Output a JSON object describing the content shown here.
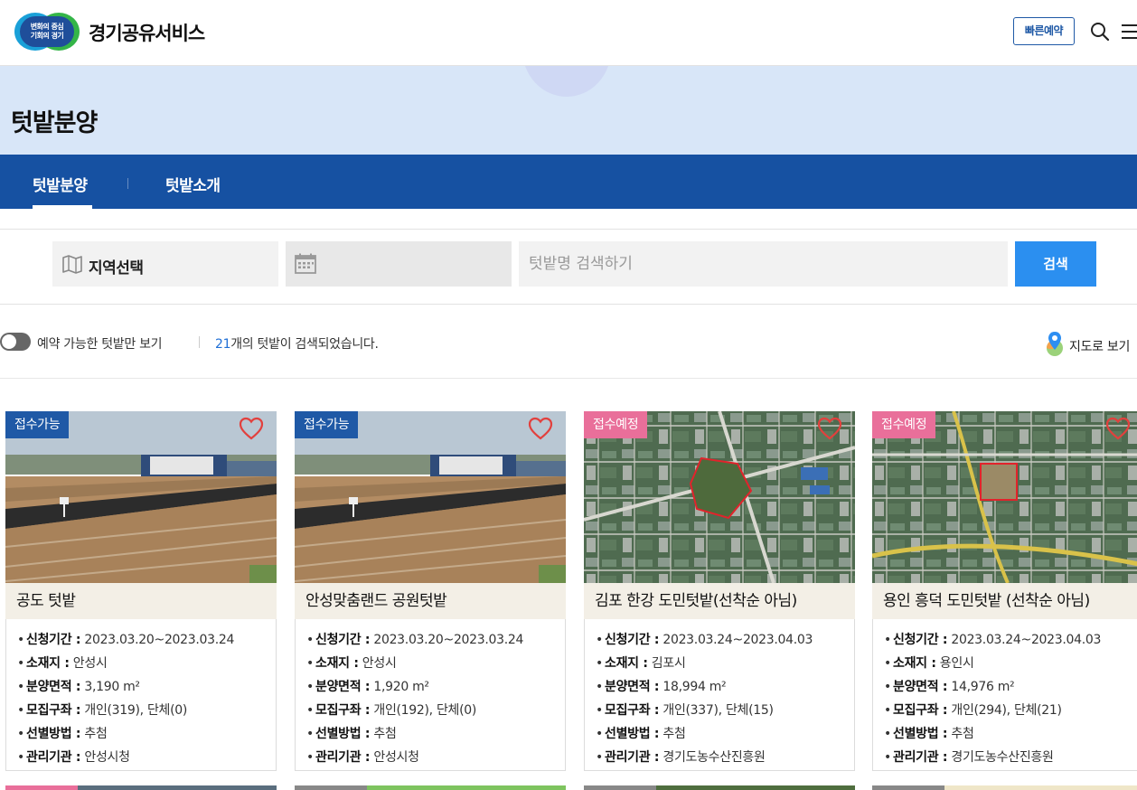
{
  "header": {
    "logo_line1": "변화의 중심",
    "logo_line2": "기회의 경기",
    "brand": "경기공유서비스",
    "quick_reserve": "빠른예약"
  },
  "hero": {
    "title": "텃밭분양"
  },
  "tabs": [
    {
      "label": "텃밭분양",
      "active": true
    },
    {
      "label": "텃밭소개",
      "active": false
    }
  ],
  "search": {
    "region_label": "지역선택",
    "date_value": "",
    "keyword_placeholder": "텃밭명 검색하기",
    "button": "검색"
  },
  "filter": {
    "toggle_label": "예약 가능한 텃밭만 보기",
    "result_count": "21",
    "result_suffix": "개의 텃밭이 검색되었습니다.",
    "map_view": "지도로 보기"
  },
  "labels": {
    "period": "신청기간 :",
    "location": "소재지 :",
    "area": "분양면적 :",
    "recruit": "모집구좌 :",
    "method": "선별방법 :",
    "agency": "관리기관 :"
  },
  "cards": [
    {
      "badge": "접수가능",
      "badge_type": "open",
      "title": "공도 텃밭",
      "period": "2023.03.20~2023.03.24",
      "location": "안성시",
      "area": "3,190 m²",
      "recruit": "개인(319), 단체(0)",
      "method": "추첨",
      "agency": "안성시청",
      "photo": "field"
    },
    {
      "badge": "접수가능",
      "badge_type": "open",
      "title": "안성맞춤랜드 공원텃밭",
      "period": "2023.03.20~2023.03.24",
      "location": "안성시",
      "area": "1,920 m²",
      "recruit": "개인(192), 단체(0)",
      "method": "추첨",
      "agency": "안성시청",
      "photo": "field"
    },
    {
      "badge": "접수예정",
      "badge_type": "soon",
      "title": "김포 한강 도민텃밭(선착순 아님)",
      "period": "2023.03.24~2023.04.03",
      "location": "김포시",
      "area": "18,994 m²",
      "recruit": "개인(337), 단체(15)",
      "method": "추첨",
      "agency": "경기도농수산진흥원",
      "photo": "satellite"
    },
    {
      "badge": "접수예정",
      "badge_type": "soon",
      "title": "용인 흥덕 도민텃밭 (선착순 아님)",
      "period": "2023.03.24~2023.04.03",
      "location": "용인시",
      "area": "14,976 m²",
      "recruit": "개인(294), 단체(21)",
      "method": "추첨",
      "agency": "경기도농수산진흥원",
      "photo": "satellite"
    }
  ],
  "colors": {
    "primary": "#1651a2",
    "accent_blue": "#2b8ff0",
    "badge_open": "#1f59a6",
    "badge_soon": "#e96f9a",
    "hero_bg": "#d8e6f8",
    "title_bar_bg": "#f3efe6"
  },
  "icons": [
    "search-icon",
    "menu-icon",
    "map-icon",
    "calendar-icon",
    "map-pin-icon",
    "heart-icon"
  ]
}
